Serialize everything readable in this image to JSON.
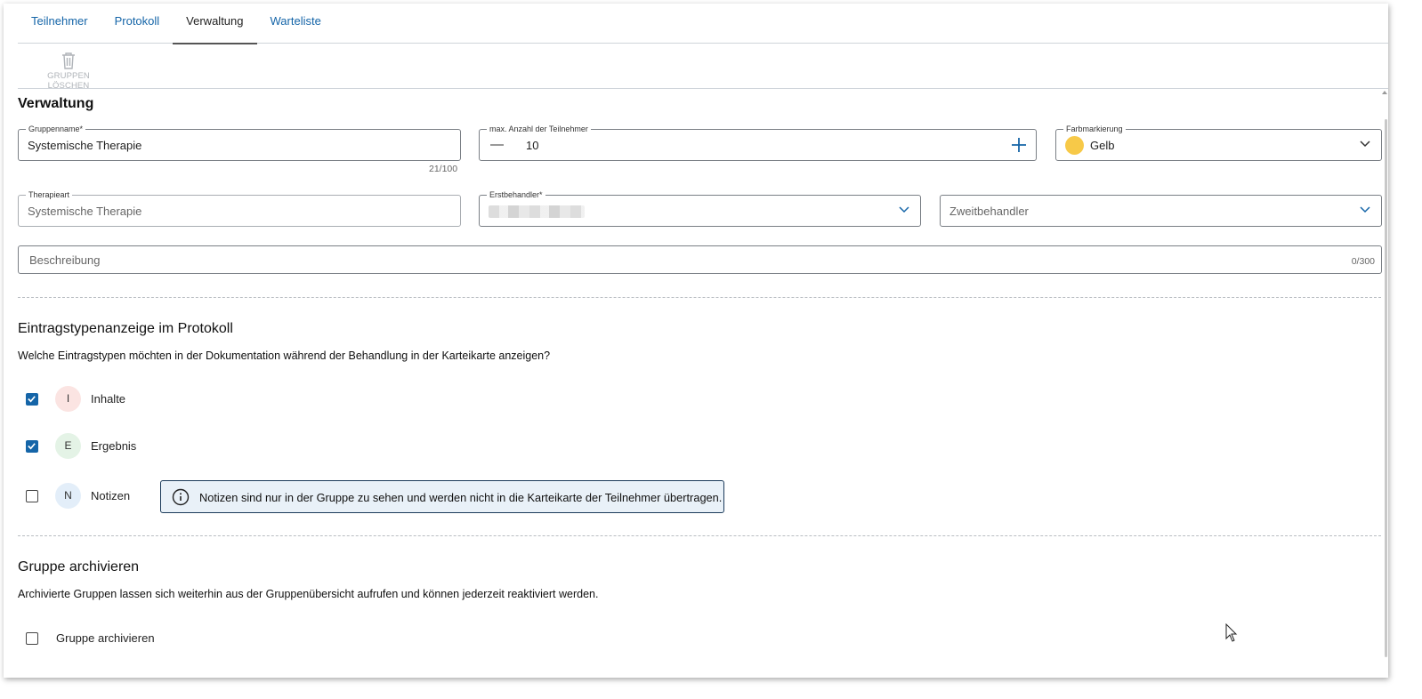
{
  "tabs": [
    {
      "label": "Teilnehmer"
    },
    {
      "label": "Protokoll"
    },
    {
      "label": "Verwaltung"
    },
    {
      "label": "Warteliste"
    }
  ],
  "active_tab": "Verwaltung",
  "toolbar": {
    "delete_groups_label": "GRUPPEN LÖSCHEN",
    "delete_icon": "trash-icon"
  },
  "section": {
    "title": "Verwaltung"
  },
  "fields": {
    "group_name": {
      "label": "Gruppenname*",
      "value": "Systemische Therapie",
      "counter": "21/100"
    },
    "max_participants": {
      "label": "max. Anzahl der Teilnehmer",
      "value": "10",
      "decrement_icon": "minus-icon",
      "increment_icon": "plus-icon"
    },
    "color_marking": {
      "label": "Farbmarkierung",
      "value": "Gelb",
      "color": "#f7c948"
    },
    "therapy_type": {
      "label": "Therapieart",
      "value": "Systemische Therapie"
    },
    "first_therapist": {
      "label": "Erstbehandler*",
      "value": ""
    },
    "second_therapist": {
      "placeholder": "Zweitbehandler"
    },
    "description": {
      "placeholder": "Beschreibung",
      "counter": "0/300"
    }
  },
  "entry_types": {
    "title": "Eintragstypenanzeige im Protokoll",
    "question": "Welche Eintragstypen möchten in der Dokumentation während der Behandlung in der Karteikarte anzeigen?",
    "items": [
      {
        "letter": "I",
        "label": "Inhalte",
        "checked": true,
        "badge_color": "#fbe4e2"
      },
      {
        "letter": "E",
        "label": "Ergebnis",
        "checked": true,
        "badge_color": "#e4f3e6"
      },
      {
        "letter": "N",
        "label": "Notizen",
        "checked": false,
        "badge_color": "#e3eef9"
      }
    ],
    "info": "Notizen sind nur in der Gruppe zu sehen und werden nicht in die Karteikarte der Teilnehmer übertragen."
  },
  "archive": {
    "title": "Gruppe archivieren",
    "description": "Archivierte Gruppen lassen sich weiterhin aus der Gruppenübersicht aufrufen und können jederzeit reaktiviert werden.",
    "checkbox_label": "Gruppe archivieren",
    "checked": false
  },
  "colors": {
    "accent": "#1565a8",
    "info_bg": "#e9f1f8"
  }
}
